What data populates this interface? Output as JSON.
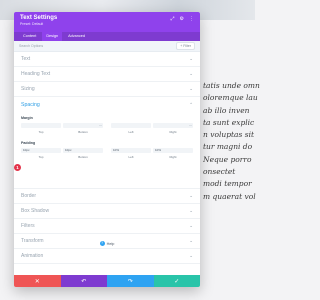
{
  "background": {
    "text_lines": [
      "tatis unde omn",
      "oloremque lau",
      "ab illo inven",
      "ta sunt explic",
      "n voluptas sit",
      "tur magni do",
      "Neque porro",
      "onsectet",
      "modi tempor",
      "m quaerat vol"
    ]
  },
  "modal": {
    "title": "Text Settings",
    "subtitle": "Preset: Default",
    "icons": [
      "expand-icon",
      "gear-icon",
      "more-icon"
    ],
    "tabs": [
      {
        "label": "Content",
        "active": false
      },
      {
        "label": "Design",
        "active": true
      },
      {
        "label": "Advanced",
        "active": false
      }
    ],
    "search_placeholder": "Search Options",
    "filter_label": "+ Filter",
    "sections_top": [
      "Text",
      "Heading Text",
      "Sizing"
    ],
    "spacing": {
      "title": "Spacing",
      "margin": {
        "label": "Margin",
        "captions": [
          "Top",
          "Bottom",
          "Left",
          "Right"
        ],
        "values": [
          "",
          "",
          "",
          ""
        ]
      },
      "padding": {
        "label": "Padding",
        "captions": [
          "Top",
          "Bottom",
          "Left",
          "Right"
        ],
        "values": [
          "10px",
          "10px",
          "10%",
          "10%"
        ]
      },
      "badge": "1"
    },
    "sections_bottom": [
      "Border",
      "Box Shadow",
      "Filters",
      "Transform",
      "Animation"
    ],
    "help_label": "Help",
    "footer": {
      "cancel": "✕",
      "undo": "↶",
      "redo": "↷",
      "save": "✓"
    }
  },
  "colors": {
    "header": "#8f42ec",
    "tabs": "#7e3bd0",
    "accent_blue": "#2ea3f2",
    "cancel": "#ef5555",
    "save": "#29c4a9",
    "badge": "#e3334a"
  }
}
